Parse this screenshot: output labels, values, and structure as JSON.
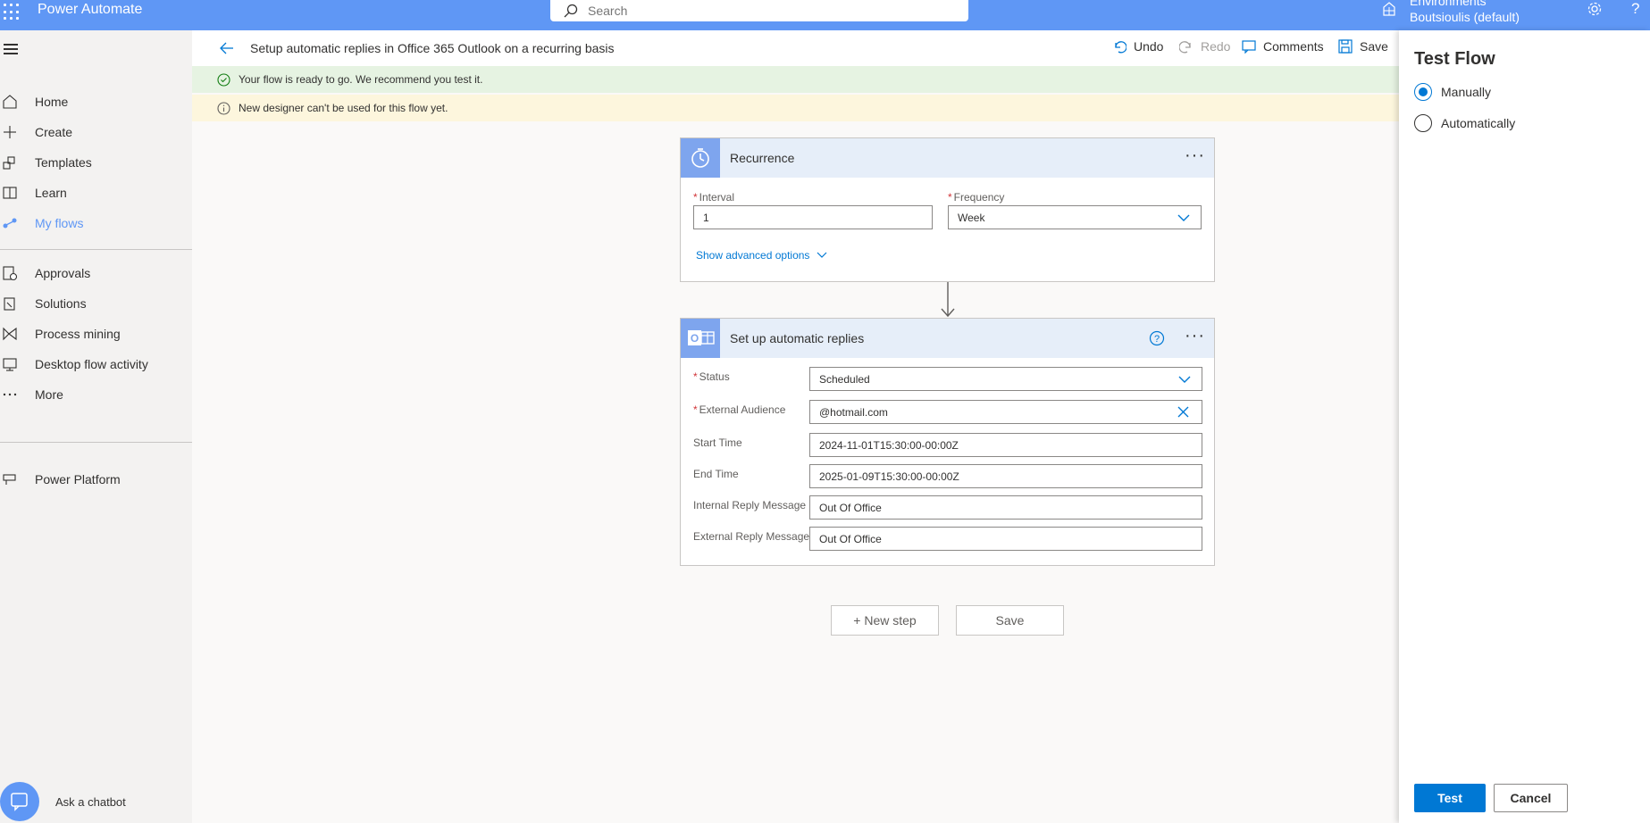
{
  "app": {
    "name": "Power Automate"
  },
  "search": {
    "placeholder": "Search"
  },
  "environment": {
    "label": "Environments",
    "name": "Boutsioulis (default)"
  },
  "nav": {
    "items": [
      {
        "label": "Home",
        "icon": "home-icon"
      },
      {
        "label": "Create",
        "icon": "plus-icon"
      },
      {
        "label": "Templates",
        "icon": "templates-icon"
      },
      {
        "label": "Learn",
        "icon": "book-icon"
      },
      {
        "label": "My flows",
        "icon": "flows-icon",
        "active": true
      },
      {
        "label": "Approvals",
        "icon": "approvals-icon"
      },
      {
        "label": "Solutions",
        "icon": "solutions-icon"
      },
      {
        "label": "Process mining",
        "icon": "process-mining-icon"
      },
      {
        "label": "Desktop flow activity",
        "icon": "desktop-flow-icon"
      },
      {
        "label": "More",
        "icon": "more-icon"
      },
      {
        "label": "Power Platform",
        "icon": "power-platform-icon"
      }
    ],
    "chatbot_label": "Ask a chatbot"
  },
  "header": {
    "flow_title": "Setup automatic replies in Office 365 Outlook on a recurring basis",
    "undo": "Undo",
    "redo": "Redo",
    "comments": "Comments",
    "save": "Save"
  },
  "banners": {
    "ready": "Your flow is ready to go. We recommend you test it.",
    "designer": "New designer can't be used for this flow yet."
  },
  "recurrence": {
    "title": "Recurrence",
    "interval_label": "Interval",
    "interval_value": "1",
    "frequency_label": "Frequency",
    "frequency_value": "Week",
    "advanced": "Show advanced options"
  },
  "autoreply": {
    "title": "Set up automatic replies",
    "status_label": "Status",
    "status_value": "Scheduled",
    "audience_label": "External Audience",
    "audience_value": "@hotmail.com",
    "start_label": "Start Time",
    "start_value": "2024-11-01T15:30:00-00:00Z",
    "end_label": "End Time",
    "end_value": "2025-01-09T15:30:00-00:00Z",
    "internal_label": "Internal Reply Message",
    "internal_value": "Out Of Office",
    "external_label": "External Reply Message",
    "external_value": "Out Of Office"
  },
  "canvas": {
    "new_step": "+ New step",
    "save": "Save"
  },
  "panel": {
    "title": "Test Flow",
    "options": [
      "Manually",
      "Automatically"
    ],
    "selected": "Manually",
    "test": "Test",
    "cancel": "Cancel"
  },
  "colors": {
    "accent": "#0078d4",
    "topbar": "#5f97f5",
    "success_bg": "#e6f3e2",
    "warning_bg": "#fdf6dd"
  }
}
